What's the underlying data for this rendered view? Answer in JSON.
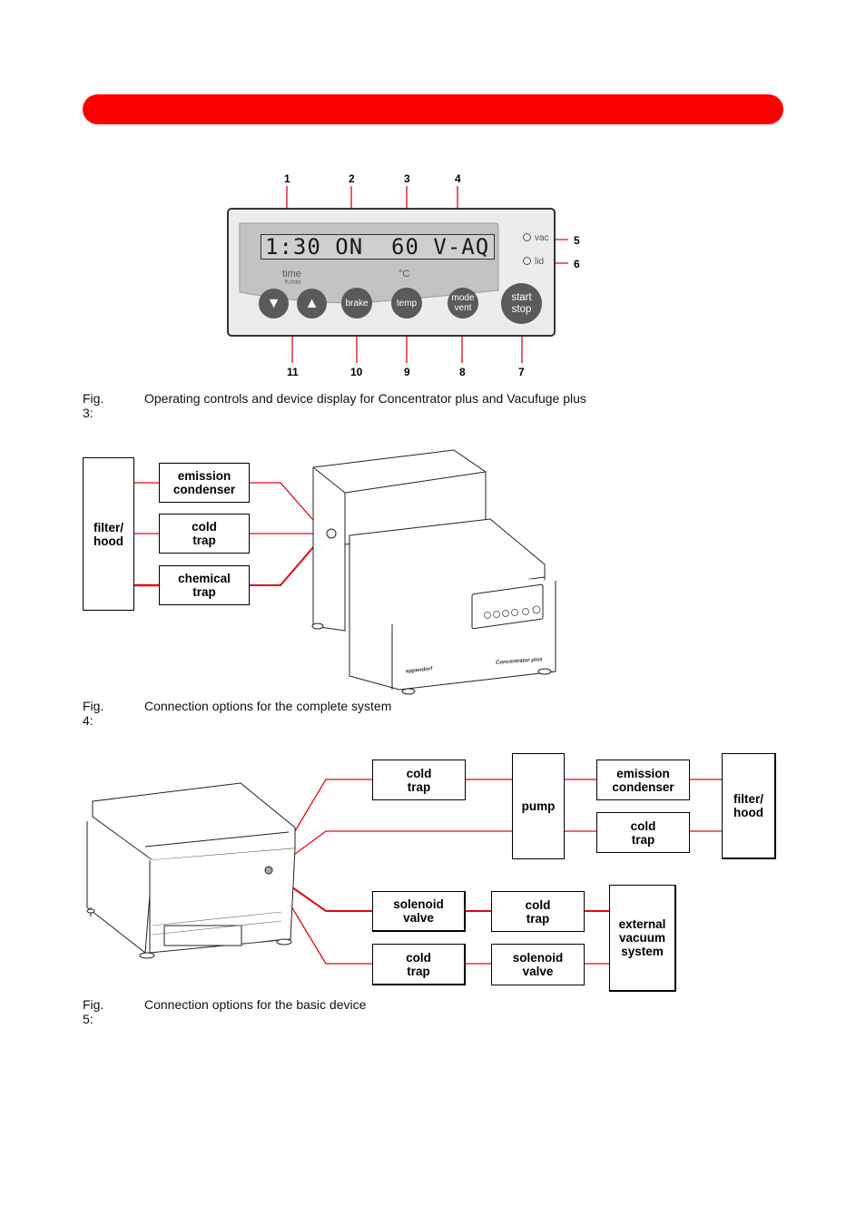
{
  "header": {
    "bar_color": "#ff0000"
  },
  "fig3": {
    "display_text": "1:30 ON  60 V-AQ",
    "time_label": "time",
    "time_unit": "h:mm",
    "temp_unit_label": "°C",
    "leds": [
      {
        "label": "vac"
      },
      {
        "label": "lid"
      }
    ],
    "buttons": {
      "down": "▼",
      "up": "▲",
      "brake": "brake",
      "temp": "temp",
      "mode_vent": "mode\nvent",
      "start_stop": "start\nstop"
    },
    "callouts_top": [
      "1",
      "2",
      "3",
      "4"
    ],
    "callouts_right": [
      "5",
      "6"
    ],
    "callouts_bottom": [
      "11",
      "10",
      "9",
      "8",
      "7"
    ],
    "caption_num": "Fig. 3:",
    "caption_text": "Operating controls and device display for Concentrator plus and Vacufuge plus"
  },
  "fig4": {
    "filter_hood": "filter/\nhood",
    "boxes": [
      "emission\ncondenser",
      "cold\ntrap",
      "chemical\ntrap"
    ],
    "device_brand": "eppendorf",
    "device_model": "Concentrator plus",
    "caption_num": "Fig. 4:",
    "caption_text": "Connection options for the complete system"
  },
  "fig5": {
    "col1": [
      "cold\ntrap",
      "solenoid\nvalve",
      "cold\ntrap"
    ],
    "pump": "pump",
    "col3_top": [
      "emission\ncondenser",
      "cold\ntrap"
    ],
    "filter_hood": "filter/\nhood",
    "col2_bottom": [
      "cold\ntrap",
      "solenoid\nvalve"
    ],
    "external": "external\nvacuum\nsystem",
    "caption_num": "Fig. 5:",
    "caption_text": "Connection options for the basic device"
  },
  "colors": {
    "line_red": "#e30613",
    "panel_bg": "#ececec",
    "lcd_bg": "#c3c3c3",
    "button_gray": "#5a5a5a"
  }
}
